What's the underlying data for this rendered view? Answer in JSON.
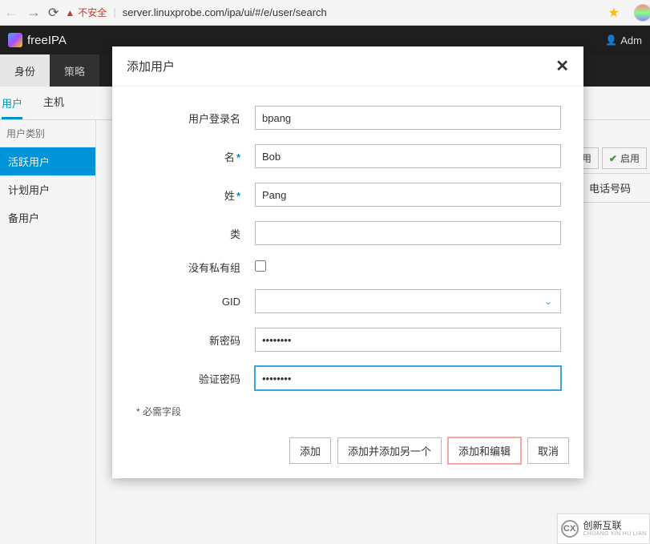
{
  "browser": {
    "insecure_label": "不安全",
    "url": "server.linuxprobe.com/ipa/ui/#/e/user/search"
  },
  "topbar": {
    "brand": "freeIPA",
    "admin_label": "Adm"
  },
  "mainnav": {
    "identity": "身份",
    "policy": "策略"
  },
  "subnav": {
    "users": "用户",
    "hosts": "主机"
  },
  "sidebar": {
    "header": "用户类别",
    "items": [
      "活跃用户",
      "计划用户",
      "备用户"
    ]
  },
  "toolbar": {
    "disable": "禁用",
    "enable": "启用"
  },
  "table": {
    "col_phone": "电话号码"
  },
  "modal": {
    "title": "添加用户",
    "labels": {
      "login": "用户登录名",
      "first": "名",
      "last": "姓",
      "class": "类",
      "noprivate": "没有私有组",
      "gid": "GID",
      "newpass": "新密码",
      "verifypass": "验证密码"
    },
    "values": {
      "login": "bpang",
      "first": "Bob",
      "last": "Pang",
      "class": "",
      "gid": "",
      "newpass": "••••••••",
      "verifypass": "••••••••"
    },
    "helper": "* 必需字段",
    "buttons": {
      "add": "添加",
      "add_another": "添加并添加另一个",
      "add_edit": "添加和编辑",
      "cancel": "取消"
    }
  },
  "watermark": {
    "text": "创新互联",
    "sub": "CHUANG XIN HU LIAN"
  }
}
